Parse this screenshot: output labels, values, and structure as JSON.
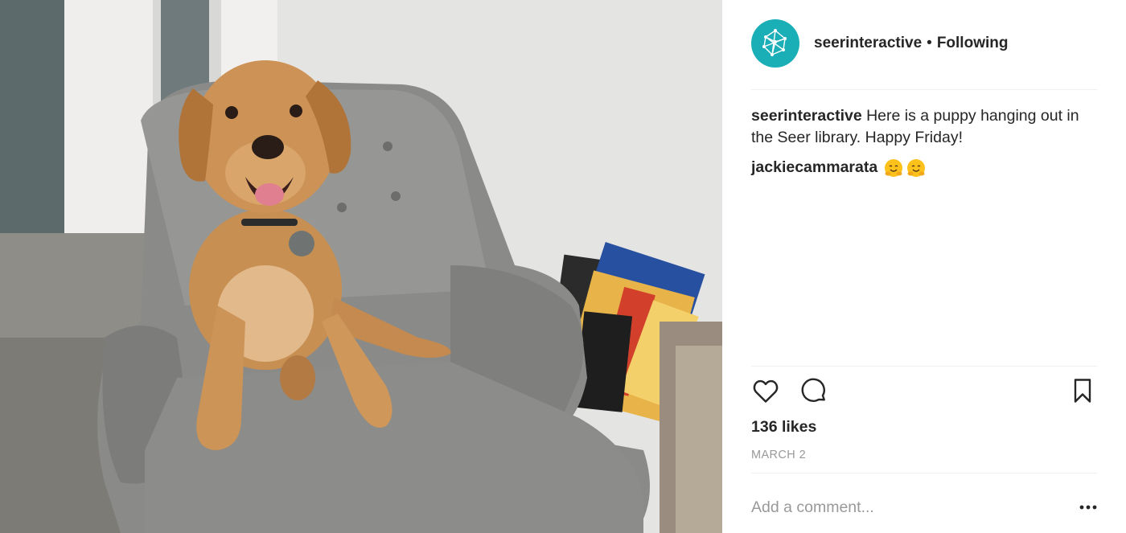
{
  "post": {
    "username": "seerinteractive",
    "separator": "•",
    "follow_status": "Following",
    "caption_username": "seerinteractive",
    "caption_text": "Here is a puppy hanging out in the Seer library. Happy Friday!",
    "likes": "136 likes",
    "date": "MARCH 2"
  },
  "comments": [
    {
      "username": "jackiecammarata",
      "emoji": [
        "hugging-face",
        "hugging-face"
      ]
    }
  ],
  "actions": {
    "like_icon": "heart-outline-icon",
    "comment_icon": "speech-bubble-icon",
    "save_icon": "bookmark-icon",
    "more_icon": "more-options-icon"
  },
  "add_comment": {
    "placeholder": "Add a comment..."
  },
  "colors": {
    "avatar_bg": "#1aaeb7",
    "muted_text": "#999999",
    "divider": "#efefef"
  }
}
